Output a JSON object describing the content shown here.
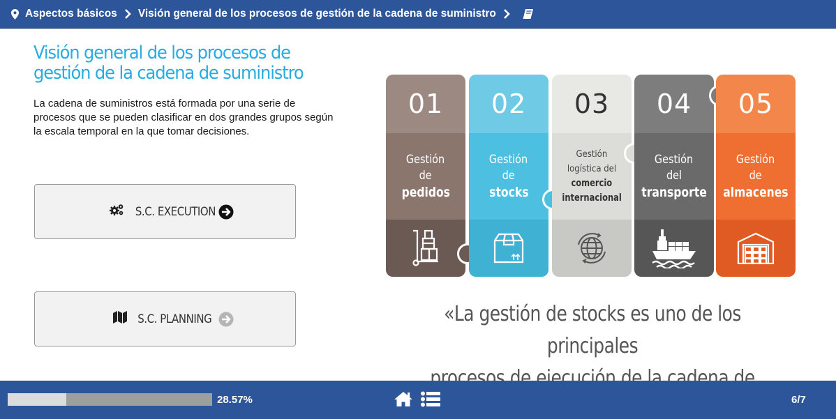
{
  "breadcrumb": {
    "items": [
      "Aspectos básicos",
      "Visión general de los procesos de gestión de la cadena de suministro"
    ]
  },
  "main": {
    "title": "Visión general de los procesos de gestión de la cadena de suministro",
    "description": "La cadena de suministros está formada por una serie de procesos que se pueden clasificar en dos grandes grupos según la escala temporal en la que tomar decisiones.",
    "buttons": [
      {
        "label": "S.C. EXECUTION",
        "icon": "gears-icon",
        "enabled": true
      },
      {
        "label": "S.C. PLANNING",
        "icon": "map-icon",
        "enabled": false
      }
    ]
  },
  "infographic": {
    "pieces": [
      {
        "num": "01",
        "line1": "Gestión",
        "line2": "de",
        "line3": "pedidos",
        "icon": "hand-truck-boxes-icon"
      },
      {
        "num": "02",
        "line1": "Gestión",
        "line2": "de",
        "line3": "stocks",
        "icon": "package-box-icon"
      },
      {
        "num": "03",
        "line1": "Gestión",
        "line2": "logística del",
        "line3": "comercio",
        "line4": "internacional",
        "icon": "globe-icon"
      },
      {
        "num": "04",
        "line1": "Gestión",
        "line2": "del",
        "line3": "transporte",
        "icon": "cargo-ship-icon"
      },
      {
        "num": "05",
        "line1": "Gestión",
        "line2": "de",
        "line3": "almacenes",
        "icon": "warehouse-icon"
      }
    ]
  },
  "quote": {
    "line1": "«La gestión de stocks es uno de los principales",
    "line2": "procesos de ejecución de la cadena de suministro.»"
  },
  "footer": {
    "progress_percent": 28.57,
    "progress_text": "28.57%",
    "page": "6/7"
  },
  "colors": {
    "bar": "#2d5599",
    "title": "#29abe2",
    "piece1": "#8a766d",
    "piece2": "#4dbfe0",
    "piece3": "#dcdcd8",
    "piece4": "#6a6a6a",
    "piece5": "#ef6f33"
  }
}
